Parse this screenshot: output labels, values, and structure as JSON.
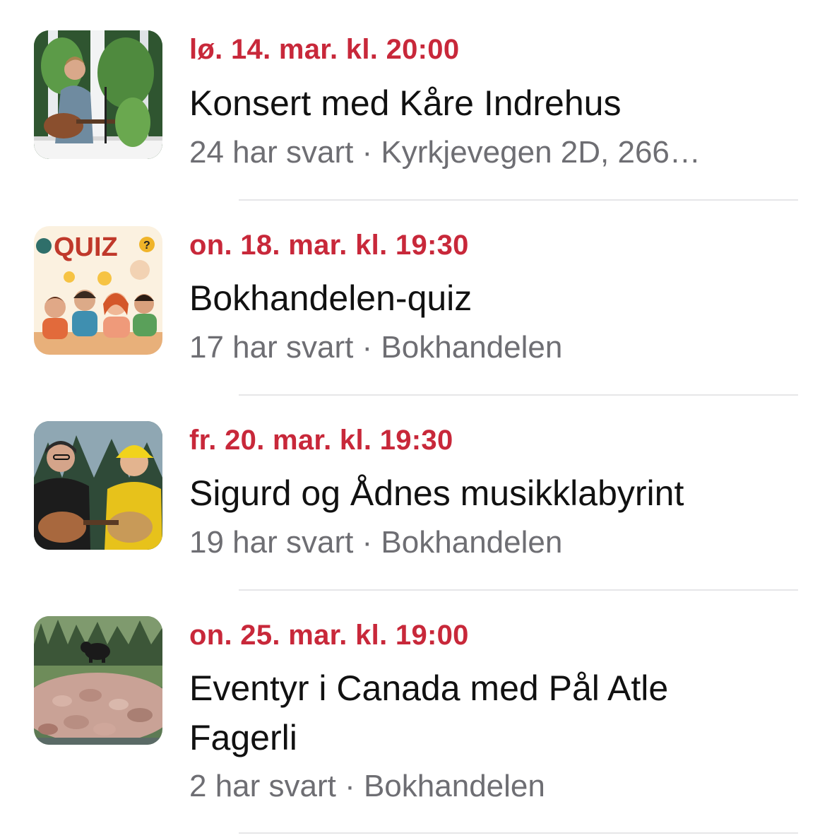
{
  "events": [
    {
      "date": "lø. 14. mar. kl. 20:00",
      "title": "Konsert med Kåre Indrehus",
      "meta": "24 har svart · Kyrkjevegen 2D, 266…",
      "thumbnail": "concert-photo"
    },
    {
      "date": "on. 18. mar. kl. 19:30",
      "title": "Bokhandelen-quiz",
      "meta": "17 har svart · Bokhandelen",
      "thumbnail": "quiz-illustration",
      "thumbnail_text": "QUIZ"
    },
    {
      "date": "fr. 20. mar. kl. 19:30",
      "title": "Sigurd og Ådnes musikklabyrint",
      "meta": "19 har svart · Bokhandelen",
      "thumbnail": "guitarists-photo"
    },
    {
      "date": "on. 25. mar. kl. 19:00",
      "title_line1": "Eventyr i Canada med Pål Atle",
      "title_line2": "Fagerli",
      "meta": "2 har svart · Bokhandelen",
      "thumbnail": "bear-photo"
    }
  ],
  "colors": {
    "date_red": "#c8283a",
    "title": "#111111",
    "meta_gray": "#6e6e73",
    "divider": "#e6e6e8"
  }
}
